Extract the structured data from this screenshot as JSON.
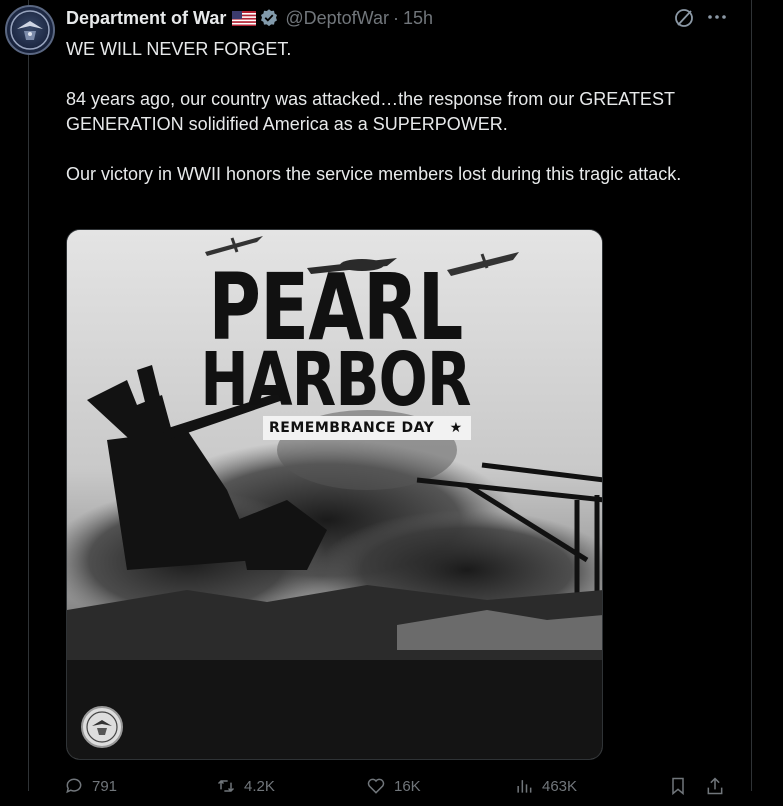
{
  "author": {
    "name": "Department of War",
    "handle": "@DeptofWar",
    "separator": "·",
    "time": "15h"
  },
  "icons": {
    "avatar": "dod-seal-avatar",
    "flag": "us-flag-icon",
    "verified": "verified-badge-icon",
    "grok": "grok-icon",
    "more": "more-icon",
    "reply": "reply-icon",
    "repost": "repost-icon",
    "like": "like-icon",
    "views": "views-icon",
    "bookmark": "bookmark-icon",
    "share": "share-icon"
  },
  "tweet": {
    "line1": "WE WILL NEVER FORGET.",
    "line2": "84 years ago, our country was attacked…the response from our GREATEST GENERATION solidified America as a SUPERPOWER.",
    "line3": "Our victory in WWII honors the service members lost during this tragic attack."
  },
  "media": {
    "title_line1": "PEARL",
    "title_line2": "HARBOR",
    "subtitle": "REMEMBRANCE DAY",
    "star": "★"
  },
  "actions": {
    "replies": "791",
    "reposts": "4.2K",
    "likes": "16K",
    "views": "463K"
  },
  "colors": {
    "background": "#000000",
    "text": "#e7e9ea",
    "muted": "#71767b",
    "verified": "#1d9bf0",
    "border": "#2f3336"
  }
}
